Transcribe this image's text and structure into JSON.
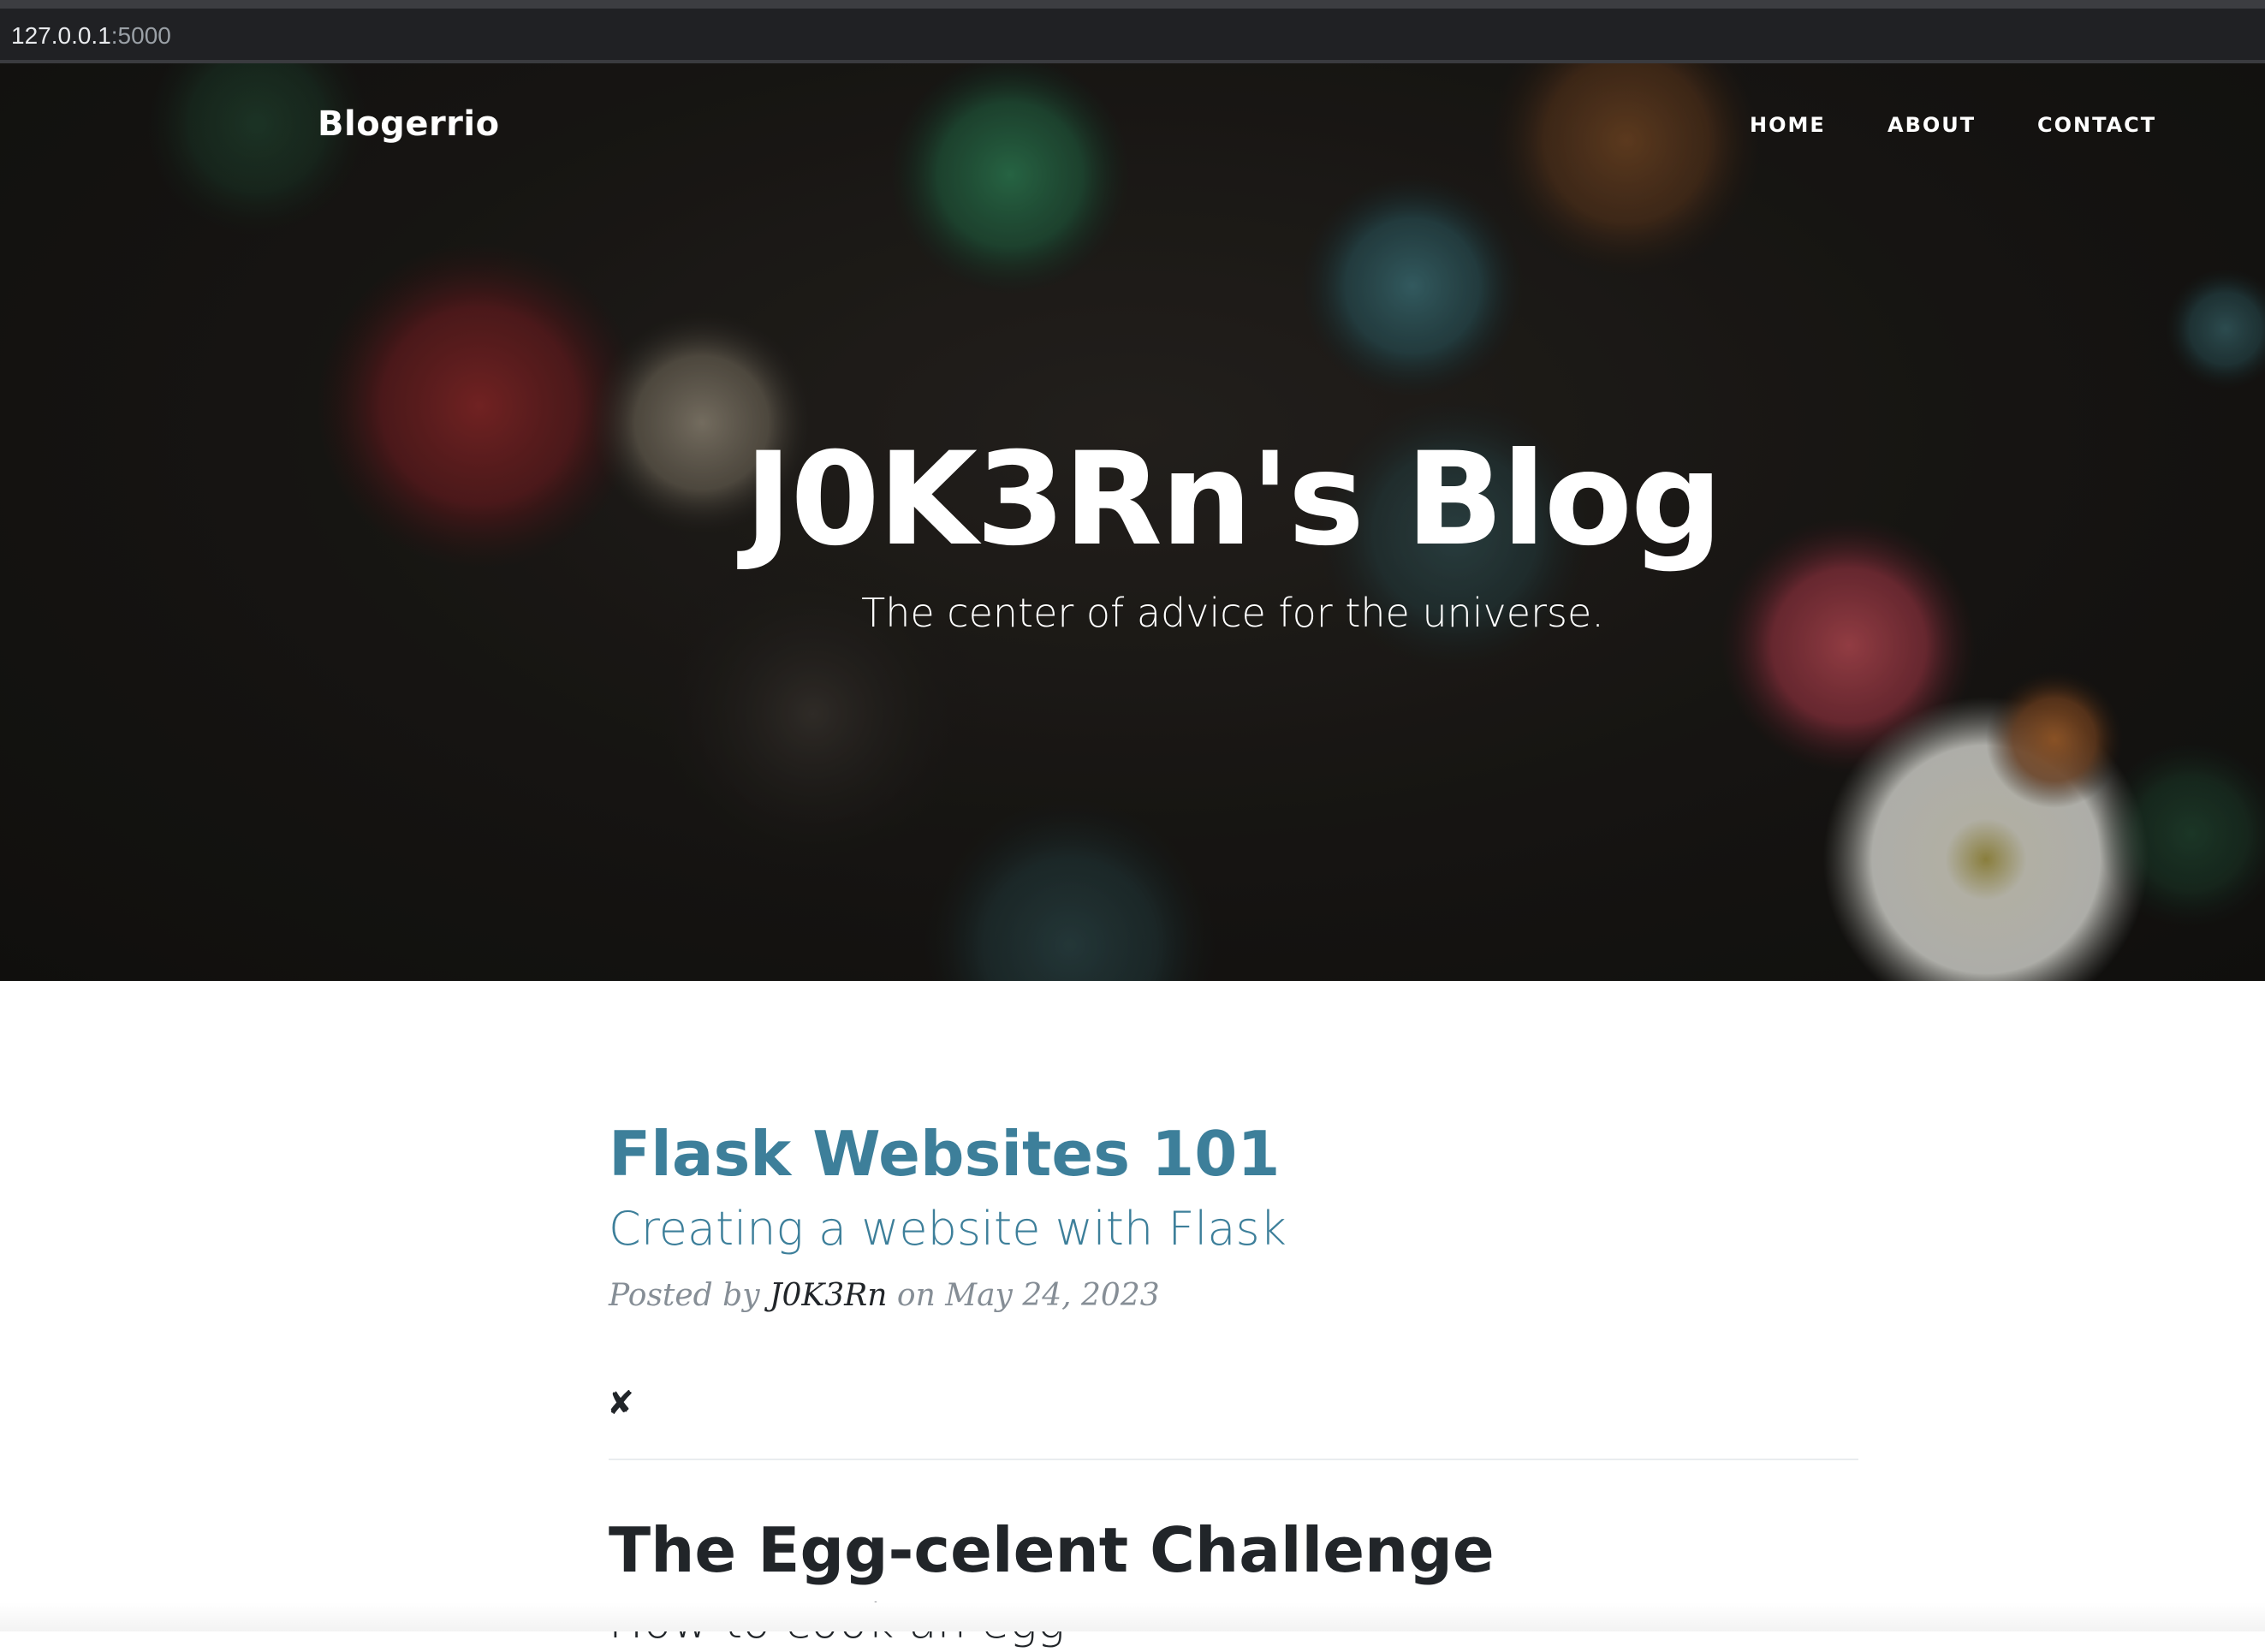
{
  "browser": {
    "address_host": "127.0.0.1",
    "address_port": ":5000"
  },
  "navbar": {
    "brand": "Blogerrio",
    "items": [
      "HOME",
      "ABOUT",
      "CONTACT"
    ]
  },
  "hero": {
    "title": "J0K3Rn's Blog",
    "subtitle": "The center of advice for the universe."
  },
  "posts": [
    {
      "title": "Flask Websites 101",
      "subtitle": "Creating a website with Flask",
      "posted_by": "Posted by",
      "author": "J0K3Rn",
      "on": "on",
      "date": "May 24, 2023",
      "delete_label": "✘"
    },
    {
      "title": "The Egg-celent Challenge",
      "subtitle": "How to cook an egg"
    }
  ],
  "colors": {
    "link_teal": "#3d7f9a",
    "text_dark": "#212529",
    "meta_gray": "#868e96"
  }
}
